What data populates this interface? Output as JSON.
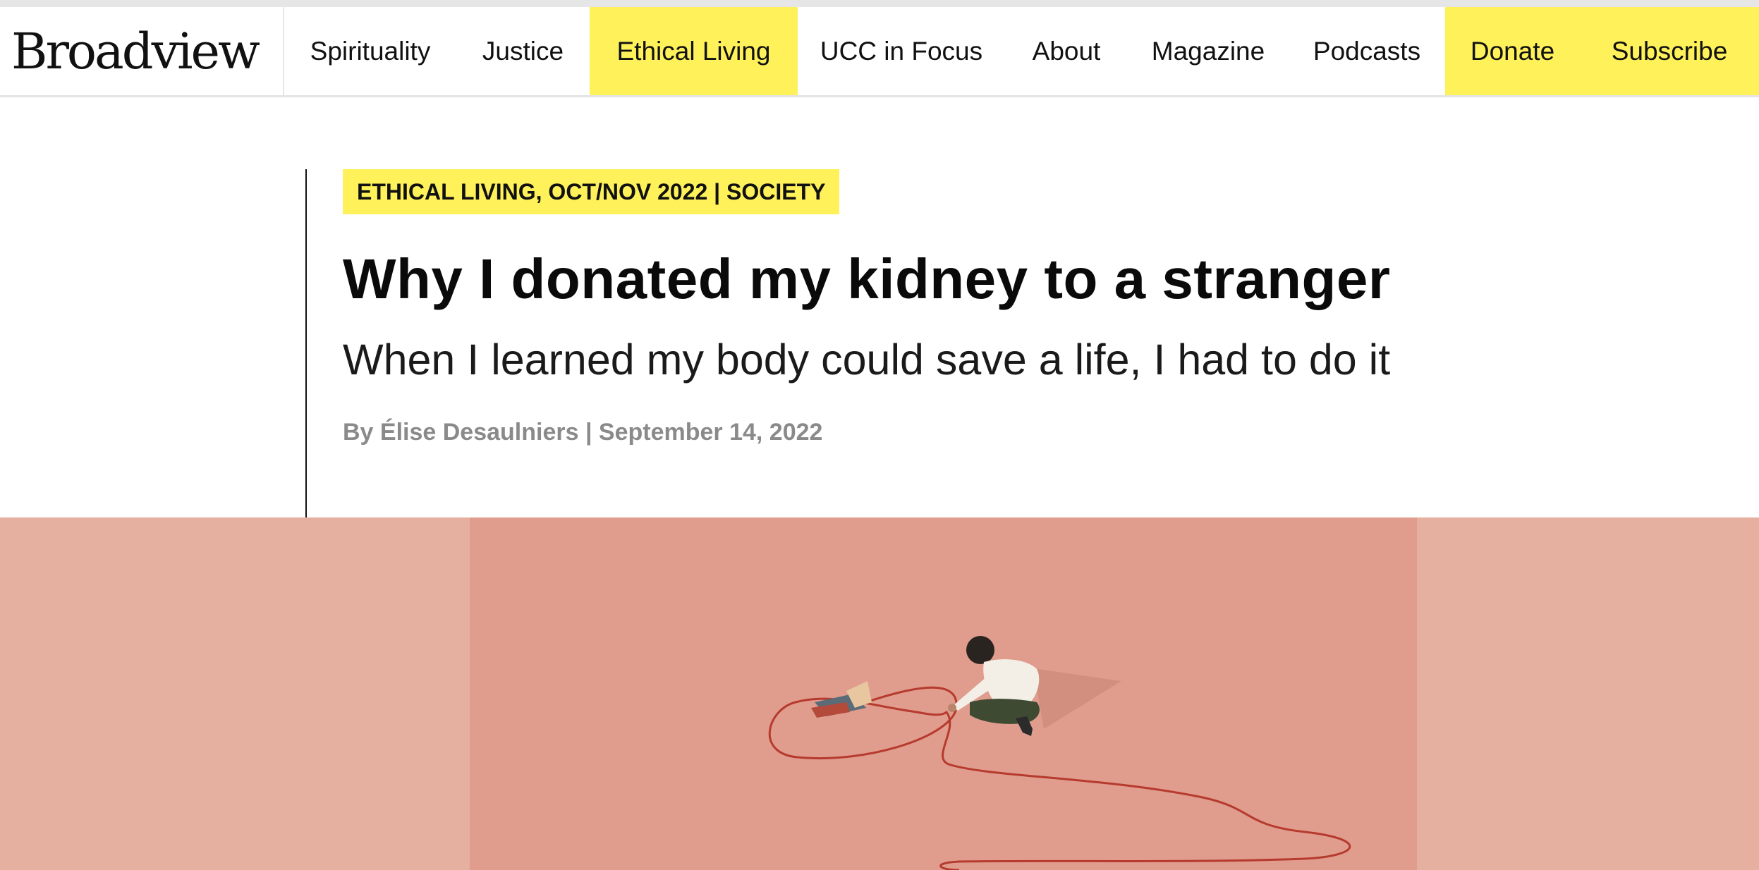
{
  "nav": {
    "logo": "Broadview",
    "items": [
      {
        "label": "Spirituality",
        "highlight": false
      },
      {
        "label": "Justice",
        "highlight": false
      },
      {
        "label": "Ethical Living",
        "highlight": true
      },
      {
        "label": "UCC in Focus",
        "highlight": false
      },
      {
        "label": "About",
        "highlight": false
      },
      {
        "label": "Magazine",
        "highlight": false
      },
      {
        "label": "Podcasts",
        "highlight": false
      },
      {
        "label": "Donate",
        "highlight": true
      },
      {
        "label": "Subscribe",
        "highlight": true
      }
    ]
  },
  "article": {
    "category": "ETHICAL LIVING, OCT/NOV 2022 | SOCIETY",
    "title": "Why I donated my kidney to a stranger",
    "subtitle": "When I learned my body could save a life, I had to do it",
    "byline": "By Élise Desaulniers | September 14, 2022"
  },
  "colors": {
    "accent_yellow": "#fef159",
    "hero_outer": "#e5b0a0",
    "hero_inner": "#e09c8d",
    "byline_gray": "#8a8a8a"
  },
  "hero": {
    "image_subject": "illustration-person-crouching-holding-red-string"
  }
}
